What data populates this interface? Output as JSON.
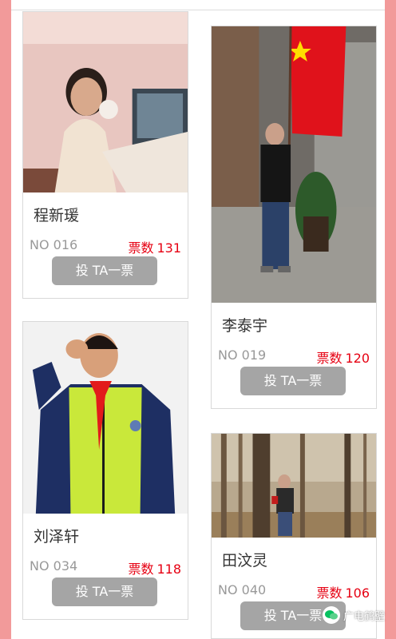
{
  "cards": [
    {
      "name": "程新瑗",
      "number": "NO 016",
      "votes_label": "票数",
      "votes": "131",
      "button": "投 TA一票"
    },
    {
      "name": "李泰宇",
      "number": "NO 019",
      "votes_label": "票数",
      "votes": "120",
      "button": "投 TA一票"
    },
    {
      "name": "刘泽轩",
      "number": "NO 034",
      "votes_label": "票数",
      "votes": "118",
      "button": "投 TA一票"
    },
    {
      "name": "田汶灵",
      "number": "NO 040",
      "votes_label": "票数",
      "votes": "106",
      "button": "投 TA一票"
    }
  ],
  "watermark": {
    "text": "广电鹤壁"
  },
  "colors": {
    "accent_stripe": "#f29a9a",
    "votes": "#e60012",
    "button": "#a5a5a5"
  }
}
